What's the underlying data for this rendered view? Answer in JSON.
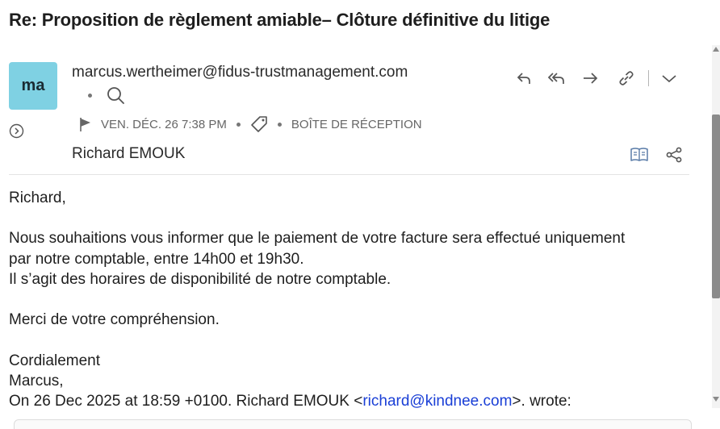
{
  "email": {
    "subject": "Re: Proposition de règlement amiable– Clôture définitive du litige",
    "avatar_initials": "ma",
    "sender": "marcus.wertheimer@fidus-trustmanagement.com",
    "date": "VEN. DÉC. 26 7:38 PM",
    "folder": "BOÎTE DE RÉCEPTION",
    "recipient": "Richard EMOUK"
  },
  "icons": {
    "reply": "reply-icon",
    "reply_all": "reply-all-icon",
    "forward": "forward-icon",
    "link": "link-icon",
    "more": "chevron-down-icon",
    "search": "search-icon",
    "flag": "flag-icon",
    "tag": "tag-icon",
    "expand": "chevron-right-circle-icon",
    "reader": "book-icon",
    "share": "share-icon"
  },
  "body": {
    "greeting": "Richard,",
    "line1": "Nous souhaitions vous informer que le paiement de votre facture sera effectué uniquement",
    "line2": "par notre comptable, entre 14h00 et 19h30.",
    "line3": "Il s’agit des horaires de disponibilité de notre comptable.",
    "thanks": "Merci de votre compréhension.",
    "closing": "Cordialement",
    "signature": "Marcus,",
    "quote_prefix": "On 26 Dec 2025 at 18:59 +0100. Richard EMOUK <",
    "quote_email": "richard@kindnee.com",
    "quote_suffix": ">. wrote:"
  },
  "colors": {
    "avatar": "#7fd1e3",
    "link": "#1a3fd6"
  }
}
